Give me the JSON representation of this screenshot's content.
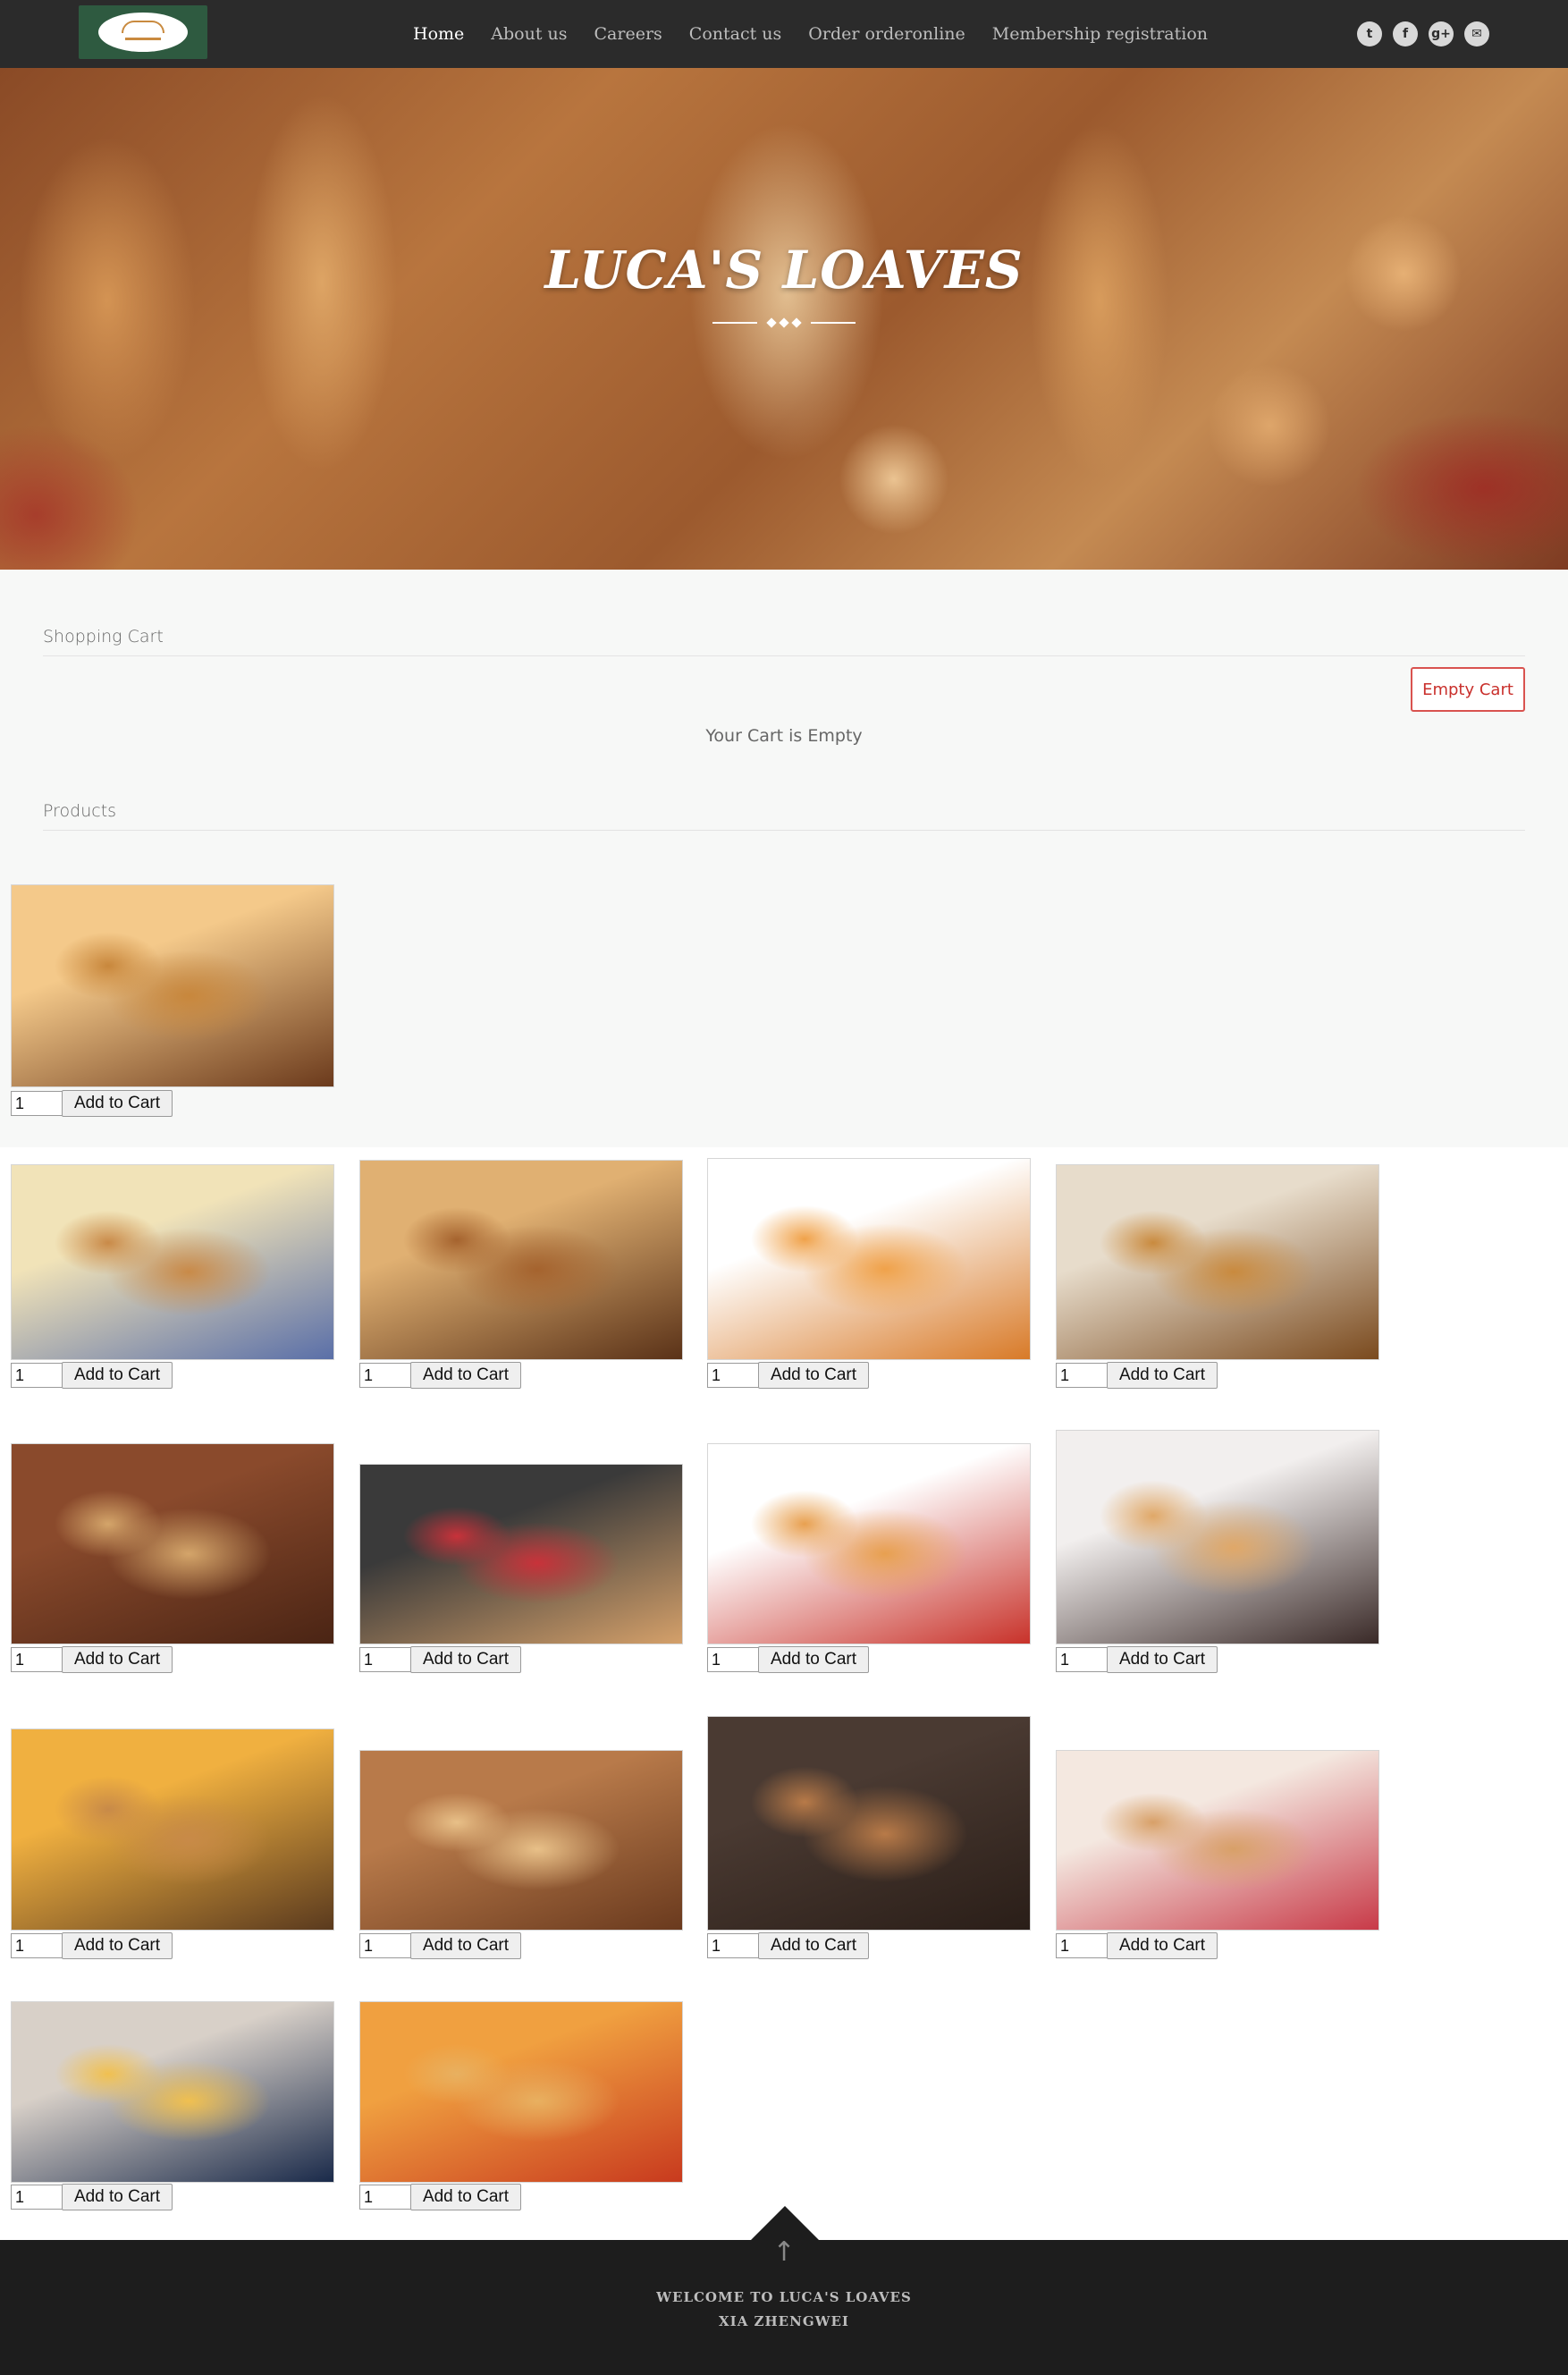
{
  "nav": {
    "items": [
      {
        "label": "Home"
      },
      {
        "label": "About us"
      },
      {
        "label": "Careers"
      },
      {
        "label": "Contact us"
      },
      {
        "label": "Order orderonline"
      },
      {
        "label": "Membership registration"
      }
    ],
    "socials": [
      {
        "icon": "twitter-icon",
        "glyph": "t"
      },
      {
        "icon": "facebook-icon",
        "glyph": "f"
      },
      {
        "icon": "google-plus-icon",
        "glyph": "g+"
      },
      {
        "icon": "email-icon",
        "glyph": "✉"
      }
    ]
  },
  "hero": {
    "title": "LUCA'S LOAVES"
  },
  "cart": {
    "heading": "Shopping Cart",
    "empty_button": "Empty Cart",
    "empty_message": "Your Cart is Empty"
  },
  "products": {
    "heading": "Products",
    "button_label": "Add to Cart",
    "default_qty": "1",
    "items": [
      {
        "image": "cream-bun-image",
        "colors": [
          "#f4c98a",
          "#c8873c",
          "#6b3a1c"
        ]
      },
      {
        "image": "sliced-loaf-image",
        "colors": [
          "#f1e3b8",
          "#c98a48",
          "#5a6fa8"
        ]
      },
      {
        "image": "rustic-bread-image",
        "colors": [
          "#e0b072",
          "#a5632e",
          "#5a3218"
        ]
      },
      {
        "image": "pretzel-rolls-image",
        "colors": [
          "#ffffff",
          "#f0a24a",
          "#d87a28"
        ]
      },
      {
        "image": "round-loaf-image",
        "colors": [
          "#e7dccb",
          "#c98a3e",
          "#7a4a1e"
        ]
      },
      {
        "image": "bread-basket-image",
        "colors": [
          "#8a4a2c",
          "#d4a56a",
          "#4a2414"
        ]
      },
      {
        "image": "croissant-berries-image",
        "colors": [
          "#3a3a3a",
          "#c8323a",
          "#d4a06a"
        ]
      },
      {
        "image": "hot-dog-image",
        "colors": [
          "#ffffff",
          "#e8a050",
          "#c8322a"
        ]
      },
      {
        "image": "striped-rolls-image",
        "colors": [
          "#f2efee",
          "#e0a868",
          "#3a2a28"
        ]
      },
      {
        "image": "wheat-breads-image",
        "colors": [
          "#f0b040",
          "#c88a48",
          "#5a3a1e"
        ]
      },
      {
        "image": "bun-basket-image",
        "colors": [
          "#b87a4a",
          "#e8c088",
          "#6a3a1e"
        ]
      },
      {
        "image": "coffee-croissant-image",
        "colors": [
          "#4a3a32",
          "#b87a48",
          "#2a1e18"
        ]
      },
      {
        "image": "breakfast-spread-image",
        "colors": [
          "#f4e8e0",
          "#d8a068",
          "#c83a48"
        ]
      },
      {
        "image": "butter-loaf-image",
        "colors": [
          "#d8d0c8",
          "#f0c050",
          "#1a2a4a"
        ]
      },
      {
        "image": "rolls-plate-image",
        "colors": [
          "#f0a040",
          "#e8b060",
          "#c83a1e"
        ]
      }
    ]
  },
  "footer": {
    "line1": "WELCOME TO LUCA'S LOAVES",
    "line2": "XIA ZHENGWEI",
    "back_to_top": "↑"
  }
}
